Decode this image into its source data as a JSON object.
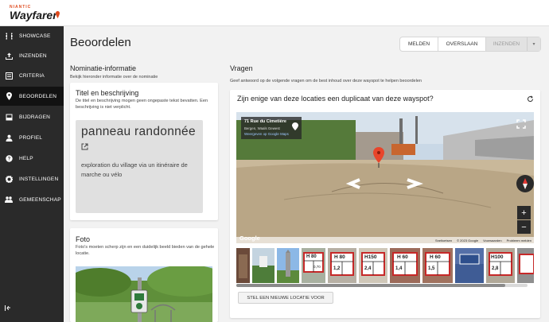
{
  "app": {
    "brand_small": "NIANTIC",
    "brand_name": "Wayfarer"
  },
  "sidebar": {
    "items": [
      {
        "label": "SHOWCASE",
        "icon": "film-icon"
      },
      {
        "label": "INZENDEN",
        "icon": "upload-icon"
      },
      {
        "label": "CRITERIA",
        "icon": "list-icon"
      },
      {
        "label": "BEOORDELEN",
        "icon": "pin-icon",
        "active": true
      },
      {
        "label": "BIJDRAGEN",
        "icon": "inbox-icon"
      },
      {
        "label": "PROFIEL",
        "icon": "person-icon"
      },
      {
        "label": "HELP",
        "icon": "help-icon"
      },
      {
        "label": "INSTELLINGEN",
        "icon": "gear-icon"
      },
      {
        "label": "GEMEENSCHAP",
        "icon": "people-icon"
      }
    ],
    "collapse_icon": "collapse-icon"
  },
  "page": {
    "title": "Beoordelen"
  },
  "actions": {
    "report": "MELDEN",
    "skip": "OVERSLAAN",
    "submit": "INZENDEN"
  },
  "nomination": {
    "heading": "Nominatie-informatie",
    "subheading": "Bekijk hieronder informatie over de nominatie",
    "title_card": {
      "heading": "Titel en beschrijving",
      "help": "De titel en beschrijving mogen geen ongepaste tekst bevatten. Een beschrijving is niet verplicht.",
      "title": "panneau randonnée",
      "description": "exploration du village via un itinéraire de marche ou vélo"
    },
    "photo_card": {
      "heading": "Foto",
      "help": "Foto's moeten scherp zijn en een duidelijk beeld bieden van de gehele locatie."
    }
  },
  "questions": {
    "heading": "Vragen",
    "subheading": "Geef antwoord op de volgende vragen om de best inhoud over deze wayspot te helpen beoordelen",
    "duplicate": {
      "question": "Zijn enige van deze locaties een duplicaat van deze wayspot?",
      "streetview": {
        "place": "71 Rue du Cimetière",
        "region": "Bergen, Waals Gewest",
        "maps_link": "Weergeven op Google Maps",
        "google": "Google",
        "footer": [
          "Sneltoetsen",
          "© 2023 Google",
          "Voorwaarden",
          "Probleem melden"
        ]
      },
      "thumbs": [
        {
          "sign": ""
        },
        {
          "sign": ""
        },
        {
          "sign": ""
        },
        {
          "sign": "H 80",
          "sub": "0,70"
        },
        {
          "sign": "H 80",
          "sub": "1,2"
        },
        {
          "sign": "H150",
          "sub": "2,4"
        },
        {
          "sign": "H 60",
          "sub": "1,4"
        },
        {
          "sign": "H 60",
          "sub": "1,5"
        },
        {
          "sign": ""
        },
        {
          "sign": "H100",
          "sub": "2,8"
        }
      ],
      "new_location_button": "STEL EEN NIEUWE LOCATIE VOOR"
    }
  }
}
